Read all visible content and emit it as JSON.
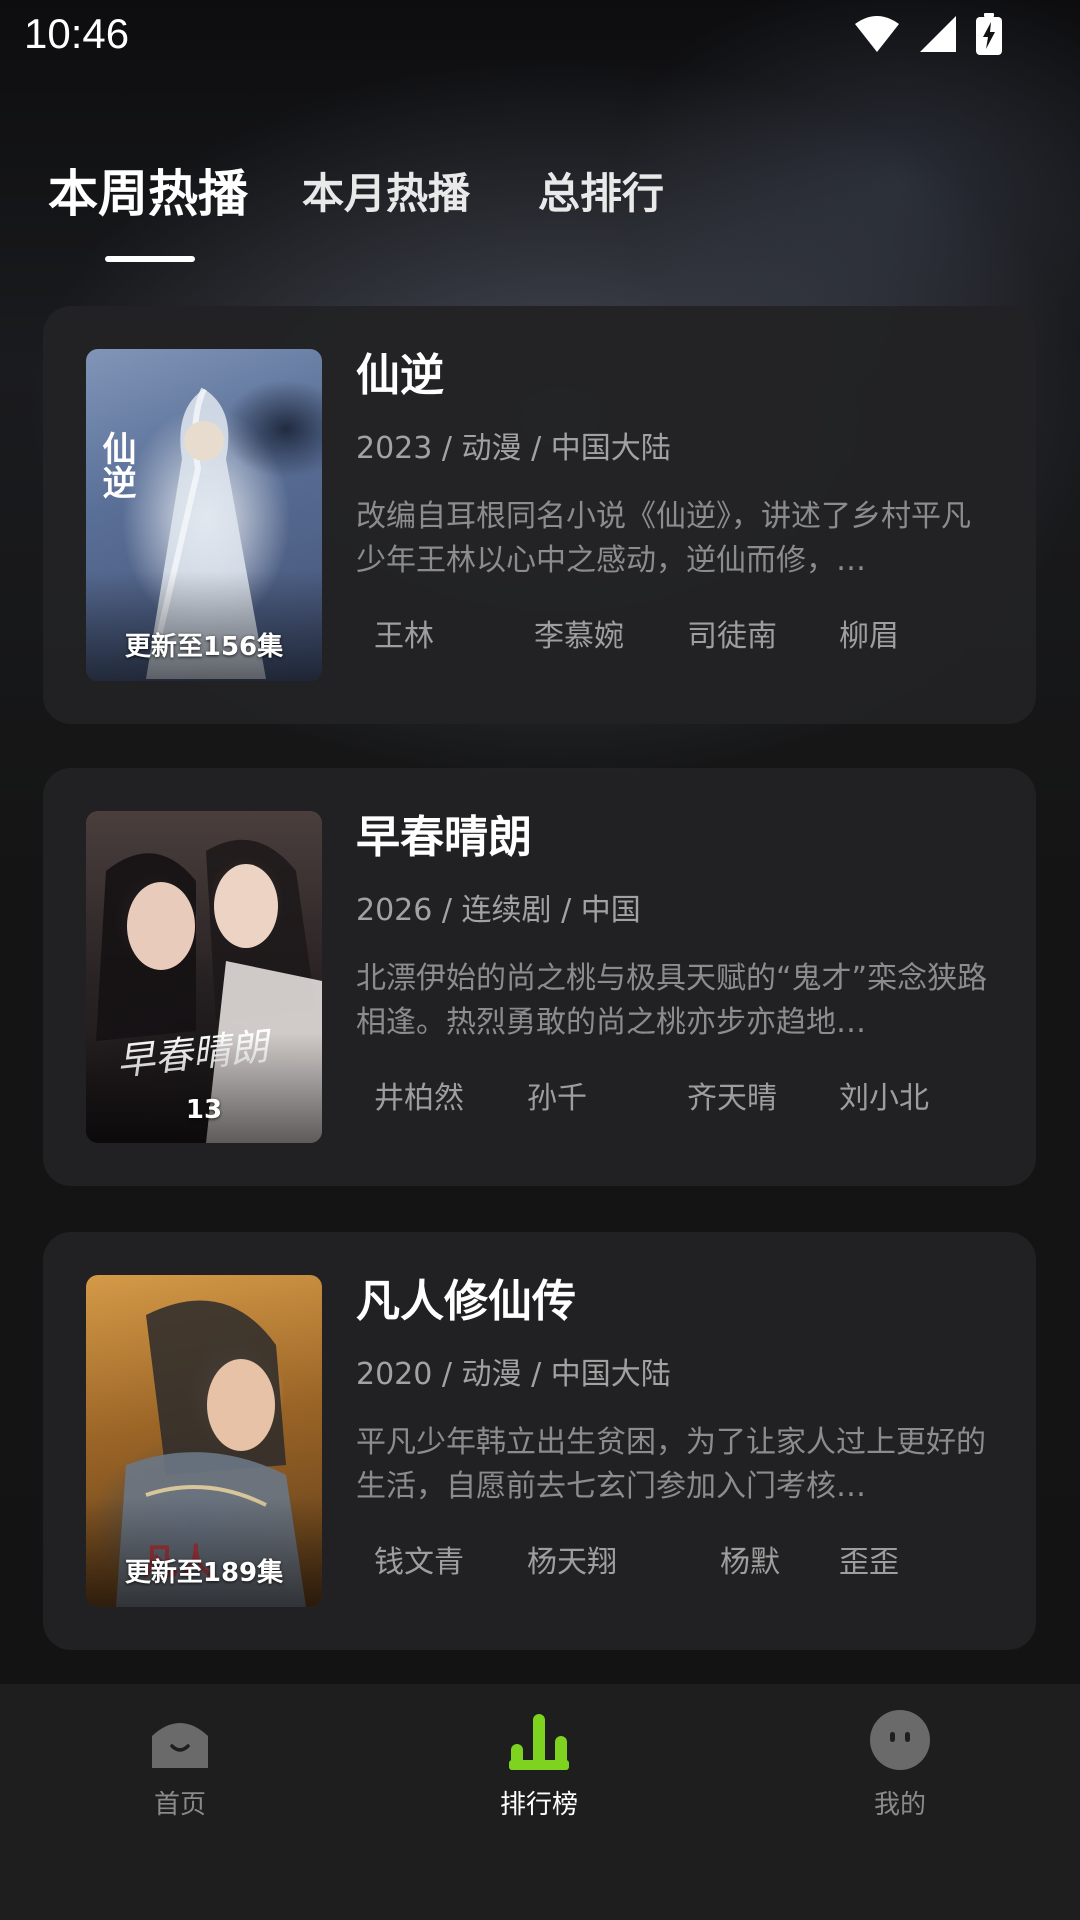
{
  "status_bar": {
    "time": "10:46",
    "icons": [
      "wifi-icon",
      "signal-icon",
      "battery-charging-icon"
    ]
  },
  "tabs": [
    {
      "label": "本周热播",
      "active": true
    },
    {
      "label": "本月热播",
      "active": false
    },
    {
      "label": "总排行",
      "active": false
    }
  ],
  "items": [
    {
      "title": "仙逆",
      "meta": "2023 / 动漫 / 中国大陆",
      "description": "改编自耳根同名小说《仙逆》，讲述了乡村平凡少年王林以心中之感动，逆仙而修，…",
      "badge": "更新至156集",
      "poster_logo": "仙逆",
      "cast": [
        "王林",
        "李慕婉",
        "司徒南",
        "柳眉"
      ]
    },
    {
      "title": "早春晴朗",
      "meta": "2026 / 连续剧 / 中国",
      "description": "北漂伊始的尚之桃与极具天赋的“鬼才”栾念狭路相逢。热烈勇敢的尚之桃亦步亦趋地…",
      "badge": "13",
      "poster_logo": "早春晴朗",
      "cast": [
        "井柏然",
        "孙千",
        "齐天晴",
        "刘小北"
      ]
    },
    {
      "title": "凡人修仙传",
      "meta": "2020 / 动漫 / 中国大陆",
      "description": "平凡少年韩立出生贫困，为了让家人过上更好的生活，自愿前去七玄门参加入门考核…",
      "badge": "更新至189集",
      "poster_logo": "凡人",
      "cast": [
        "钱文青",
        "杨天翔",
        "杨默",
        "歪歪"
      ]
    }
  ],
  "bottom_nav": [
    {
      "label": "首页",
      "icon": "home-icon",
      "active": false
    },
    {
      "label": "排行榜",
      "icon": "ranking-icon",
      "active": true
    },
    {
      "label": "我的",
      "icon": "profile-icon",
      "active": false
    }
  ],
  "colors": {
    "accent": "#7ed321",
    "card": "#222224",
    "text_secondary": "#a2a2a2"
  }
}
